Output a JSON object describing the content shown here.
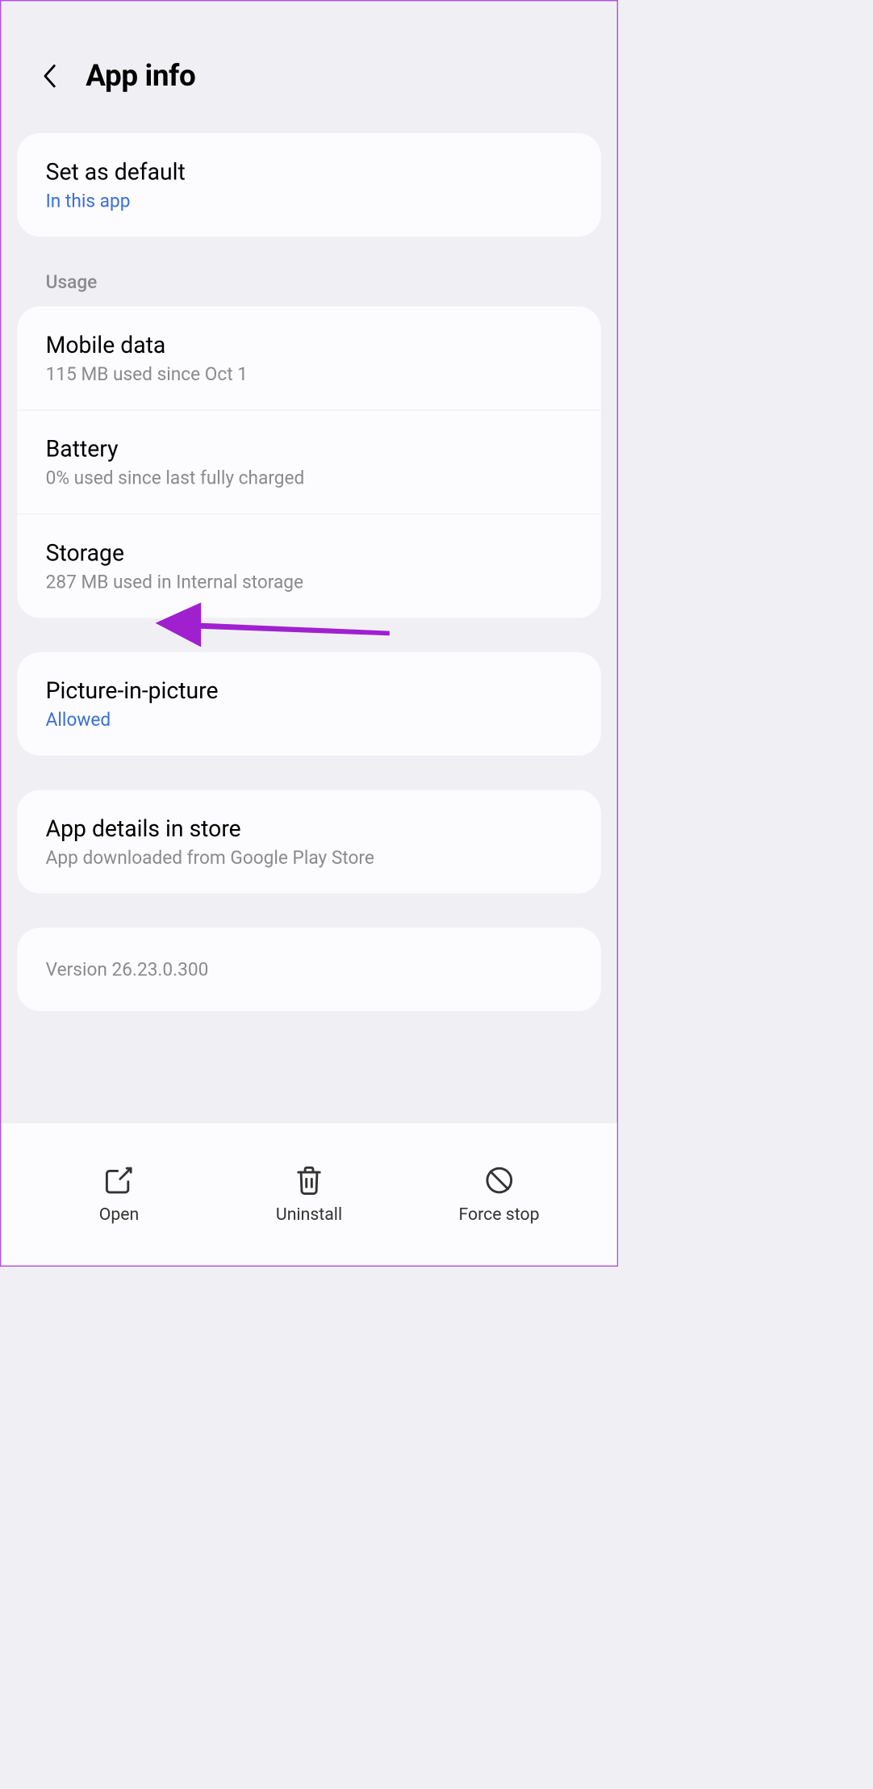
{
  "header": {
    "title": "App info"
  },
  "default_card": {
    "title": "Set as default",
    "sub": "In this app"
  },
  "usage_section": {
    "header": "Usage",
    "mobile_data": {
      "title": "Mobile data",
      "sub": "115 MB used since Oct 1"
    },
    "battery": {
      "title": "Battery",
      "sub": "0% used since last fully charged"
    },
    "storage": {
      "title": "Storage",
      "sub": "287 MB used in Internal storage"
    }
  },
  "pip_card": {
    "title": "Picture-in-picture",
    "sub": "Allowed"
  },
  "store_card": {
    "title": "App details in store",
    "sub": "App downloaded from Google Play Store"
  },
  "version": "Version 26.23.0.300",
  "bottom": {
    "open": "Open",
    "uninstall": "Uninstall",
    "force_stop": "Force stop"
  },
  "annotation": {
    "color": "#a020d0"
  }
}
